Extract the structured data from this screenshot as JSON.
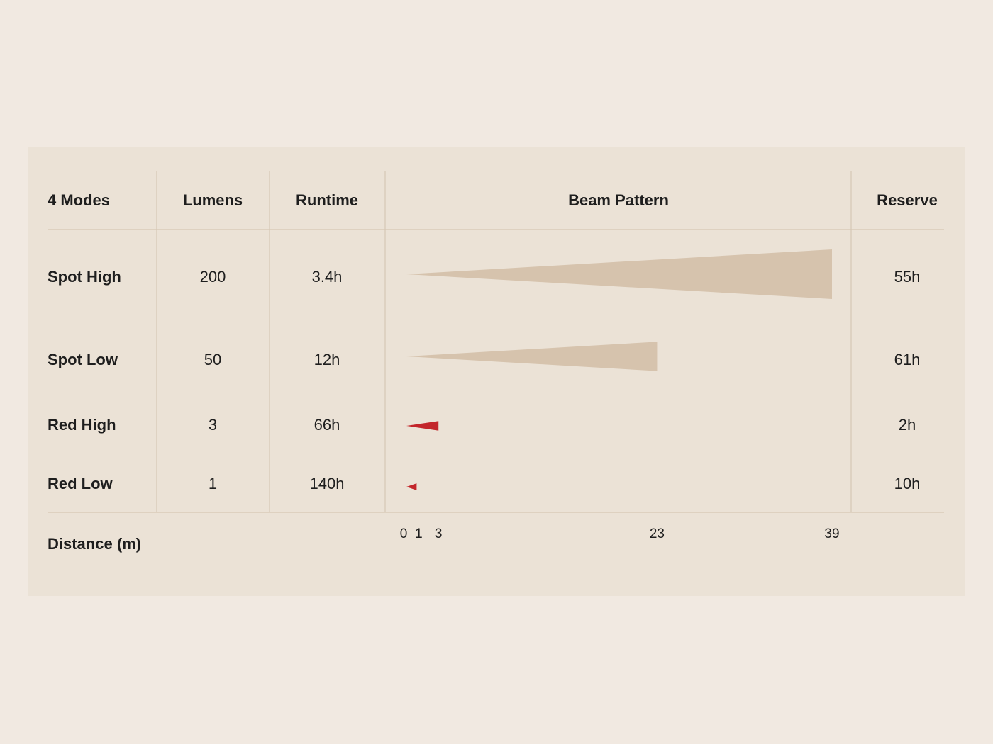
{
  "colors": {
    "page_background": "#f1e9e1",
    "panel_background": "#ebe2d6",
    "grid_line": "#d6c7b4",
    "spot_beam": "#d6c3ad",
    "red_beam": "#c3262b"
  },
  "table": {
    "headers": {
      "modes": "4 Modes",
      "lumens": "Lumens",
      "runtime": "Runtime",
      "beam_pattern": "Beam Pattern",
      "reserve": "Reserve"
    },
    "rows": [
      {
        "mode": "Spot High",
        "lumens": "200",
        "runtime": "3.4h",
        "reserve": "55h"
      },
      {
        "mode": "Spot Low",
        "lumens": "50",
        "runtime": "12h",
        "reserve": "61h"
      },
      {
        "mode": "Red High",
        "lumens": "3",
        "runtime": "66h",
        "reserve": "2h"
      },
      {
        "mode": "Red Low",
        "lumens": "1",
        "runtime": "140h",
        "reserve": "10h"
      }
    ],
    "footer_label": "Distance (m)"
  },
  "chart_data": {
    "type": "bar",
    "title": "Beam Pattern",
    "xlabel": "Distance (m)",
    "categories": [
      "Spot High",
      "Spot Low",
      "Red High",
      "Red Low"
    ],
    "values": [
      39,
      23,
      3,
      1
    ],
    "beam_color": [
      "spot",
      "spot",
      "red",
      "red"
    ],
    "x_ticks": [
      "0",
      "1",
      "3",
      "23",
      "39"
    ],
    "xlim": [
      0,
      39
    ]
  }
}
